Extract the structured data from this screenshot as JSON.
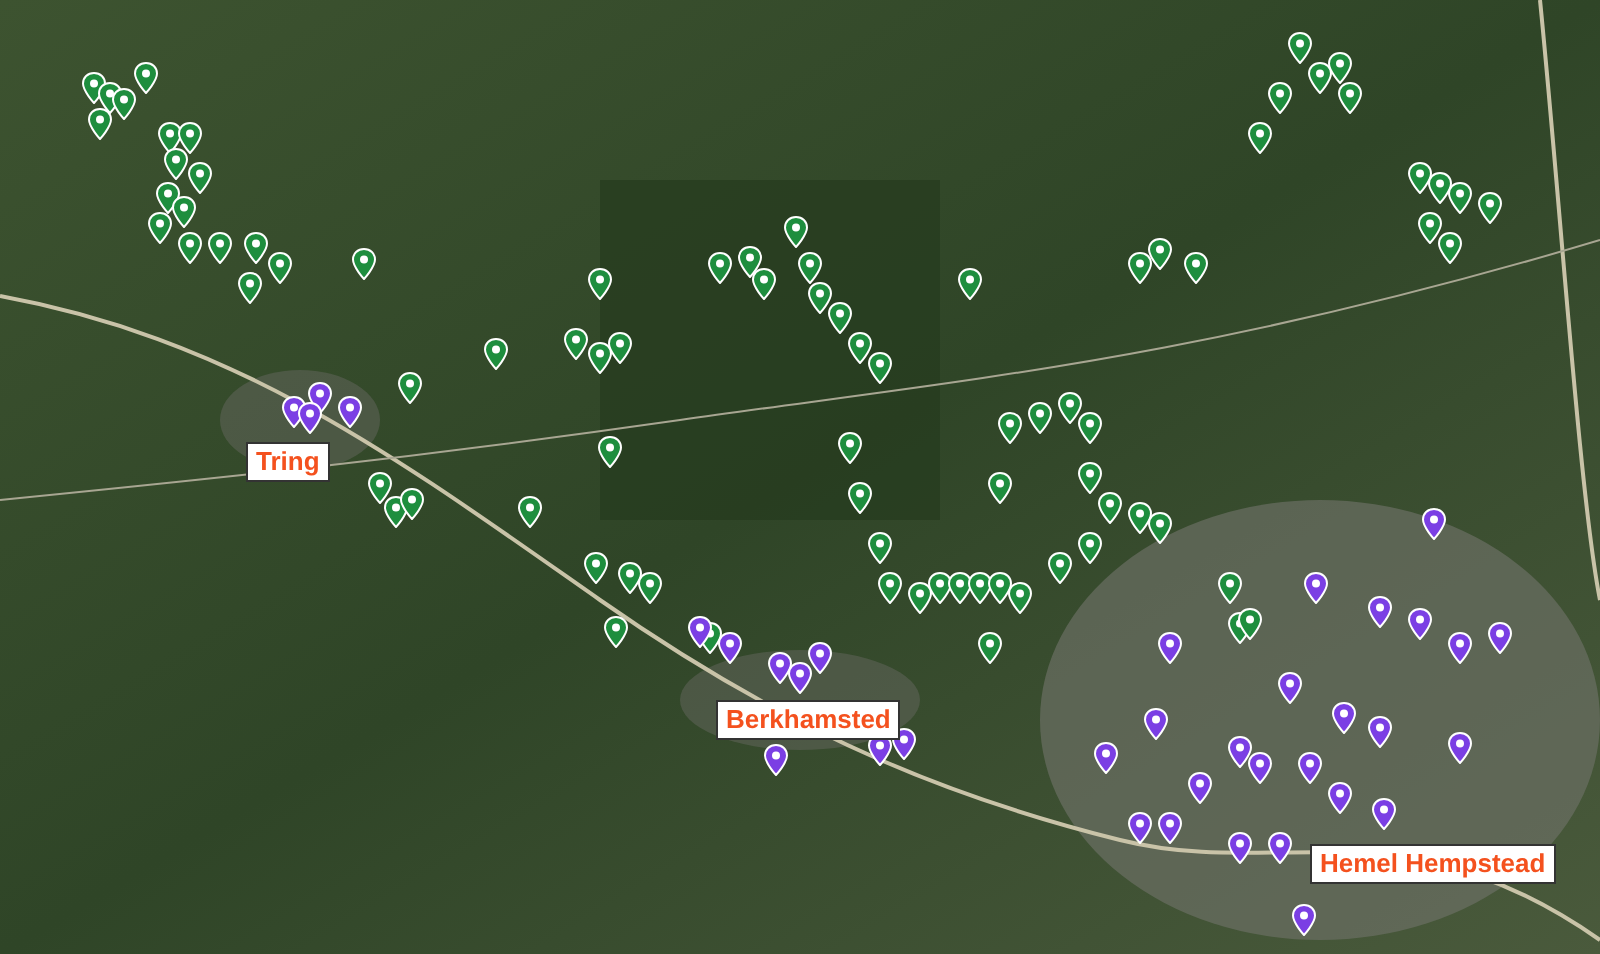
{
  "map": {
    "town_labels": [
      {
        "text": "Tring"
      },
      {
        "text": "Berkhamsted"
      },
      {
        "text": "Hemel Hempstead"
      }
    ],
    "pins": [
      {
        "color": "#1e8e3e"
      },
      {
        "color": "#1e8e3e"
      },
      {
        "color": "#1e8e3e"
      },
      {
        "color": "#1e8e3e"
      },
      {
        "color": "#1e8e3e"
      },
      {
        "color": "#1e8e3e"
      },
      {
        "color": "#1e8e3e"
      },
      {
        "color": "#1e8e3e"
      },
      {
        "color": "#1e8e3e"
      },
      {
        "color": "#1e8e3e"
      },
      {
        "color": "#1e8e3e"
      },
      {
        "color": "#1e8e3e"
      },
      {
        "color": "#1e8e3e"
      },
      {
        "color": "#1e8e3e"
      },
      {
        "color": "#1e8e3e"
      },
      {
        "color": "#1e8e3e"
      },
      {
        "color": "#1e8e3e"
      },
      {
        "color": "#1e8e3e"
      },
      {
        "color": "#1e8e3e"
      },
      {
        "color": "#1e8e3e"
      },
      {
        "color": "#1e8e3e"
      },
      {
        "color": "#1e8e3e"
      },
      {
        "color": "#1e8e3e"
      },
      {
        "color": "#1e8e3e"
      },
      {
        "color": "#1e8e3e"
      },
      {
        "color": "#1e8e3e"
      },
      {
        "color": "#1e8e3e"
      },
      {
        "color": "#1e8e3e"
      },
      {
        "color": "#1e8e3e"
      },
      {
        "color": "#1e8e3e"
      },
      {
        "color": "#1e8e3e"
      },
      {
        "color": "#1e8e3e"
      },
      {
        "color": "#1e8e3e"
      },
      {
        "color": "#1e8e3e"
      },
      {
        "color": "#1e8e3e"
      },
      {
        "color": "#1e8e3e"
      },
      {
        "color": "#1e8e3e"
      },
      {
        "color": "#1e8e3e"
      },
      {
        "color": "#1e8e3e"
      },
      {
        "color": "#1e8e3e"
      },
      {
        "color": "#1e8e3e"
      },
      {
        "color": "#1e8e3e"
      },
      {
        "color": "#1e8e3e"
      },
      {
        "color": "#1e8e3e"
      },
      {
        "color": "#1e8e3e"
      },
      {
        "color": "#1e8e3e"
      },
      {
        "color": "#1e8e3e"
      },
      {
        "color": "#1e8e3e"
      },
      {
        "color": "#1e8e3e"
      },
      {
        "color": "#1e8e3e"
      },
      {
        "color": "#1e8e3e"
      },
      {
        "color": "#1e8e3e"
      },
      {
        "color": "#1e8e3e"
      },
      {
        "color": "#1e8e3e"
      },
      {
        "color": "#1e8e3e"
      },
      {
        "color": "#1e8e3e"
      },
      {
        "color": "#1e8e3e"
      },
      {
        "color": "#1e8e3e"
      },
      {
        "color": "#1e8e3e"
      },
      {
        "color": "#1e8e3e"
      },
      {
        "color": "#1e8e3e"
      },
      {
        "color": "#1e8e3e"
      },
      {
        "color": "#1e8e3e"
      },
      {
        "color": "#1e8e3e"
      },
      {
        "color": "#1e8e3e"
      },
      {
        "color": "#1e8e3e"
      },
      {
        "color": "#1e8e3e"
      },
      {
        "color": "#1e8e3e"
      },
      {
        "color": "#1e8e3e"
      },
      {
        "color": "#1e8e3e"
      },
      {
        "color": "#1e8e3e"
      },
      {
        "color": "#1e8e3e"
      },
      {
        "color": "#1e8e3e"
      },
      {
        "color": "#1e8e3e"
      },
      {
        "color": "#1e8e3e"
      },
      {
        "color": "#1e8e3e"
      },
      {
        "color": "#1e8e3e"
      },
      {
        "color": "#1e8e3e"
      },
      {
        "color": "#1e8e3e"
      },
      {
        "color": "#1e8e3e"
      },
      {
        "color": "#1e8e3e"
      },
      {
        "color": "#1e8e3e"
      },
      {
        "color": "#1e8e3e"
      },
      {
        "color": "#1e8e3e"
      },
      {
        "color": "#7b3fe4"
      },
      {
        "color": "#7b3fe4"
      },
      {
        "color": "#7b3fe4"
      },
      {
        "color": "#7b3fe4"
      },
      {
        "color": "#7b3fe4"
      },
      {
        "color": "#7b3fe4"
      },
      {
        "color": "#7b3fe4"
      },
      {
        "color": "#7b3fe4"
      },
      {
        "color": "#7b3fe4"
      },
      {
        "color": "#7b3fe4"
      },
      {
        "color": "#7b3fe4"
      },
      {
        "color": "#7b3fe4"
      },
      {
        "color": "#7b3fe4"
      },
      {
        "color": "#7b3fe4"
      },
      {
        "color": "#7b3fe4"
      },
      {
        "color": "#7b3fe4"
      },
      {
        "color": "#7b3fe4"
      },
      {
        "color": "#7b3fe4"
      },
      {
        "color": "#7b3fe4"
      },
      {
        "color": "#7b3fe4"
      },
      {
        "color": "#7b3fe4"
      },
      {
        "color": "#7b3fe4"
      },
      {
        "color": "#7b3fe4"
      },
      {
        "color": "#7b3fe4"
      },
      {
        "color": "#7b3fe4"
      },
      {
        "color": "#7b3fe4"
      },
      {
        "color": "#7b3fe4"
      },
      {
        "color": "#7b3fe4"
      },
      {
        "color": "#7b3fe4"
      },
      {
        "color": "#7b3fe4"
      },
      {
        "color": "#7b3fe4"
      },
      {
        "color": "#7b3fe4"
      },
      {
        "color": "#7b3fe4"
      },
      {
        "color": "#7b3fe4"
      },
      {
        "color": "#7b3fe4"
      },
      {
        "color": "#7b3fe4"
      }
    ]
  }
}
